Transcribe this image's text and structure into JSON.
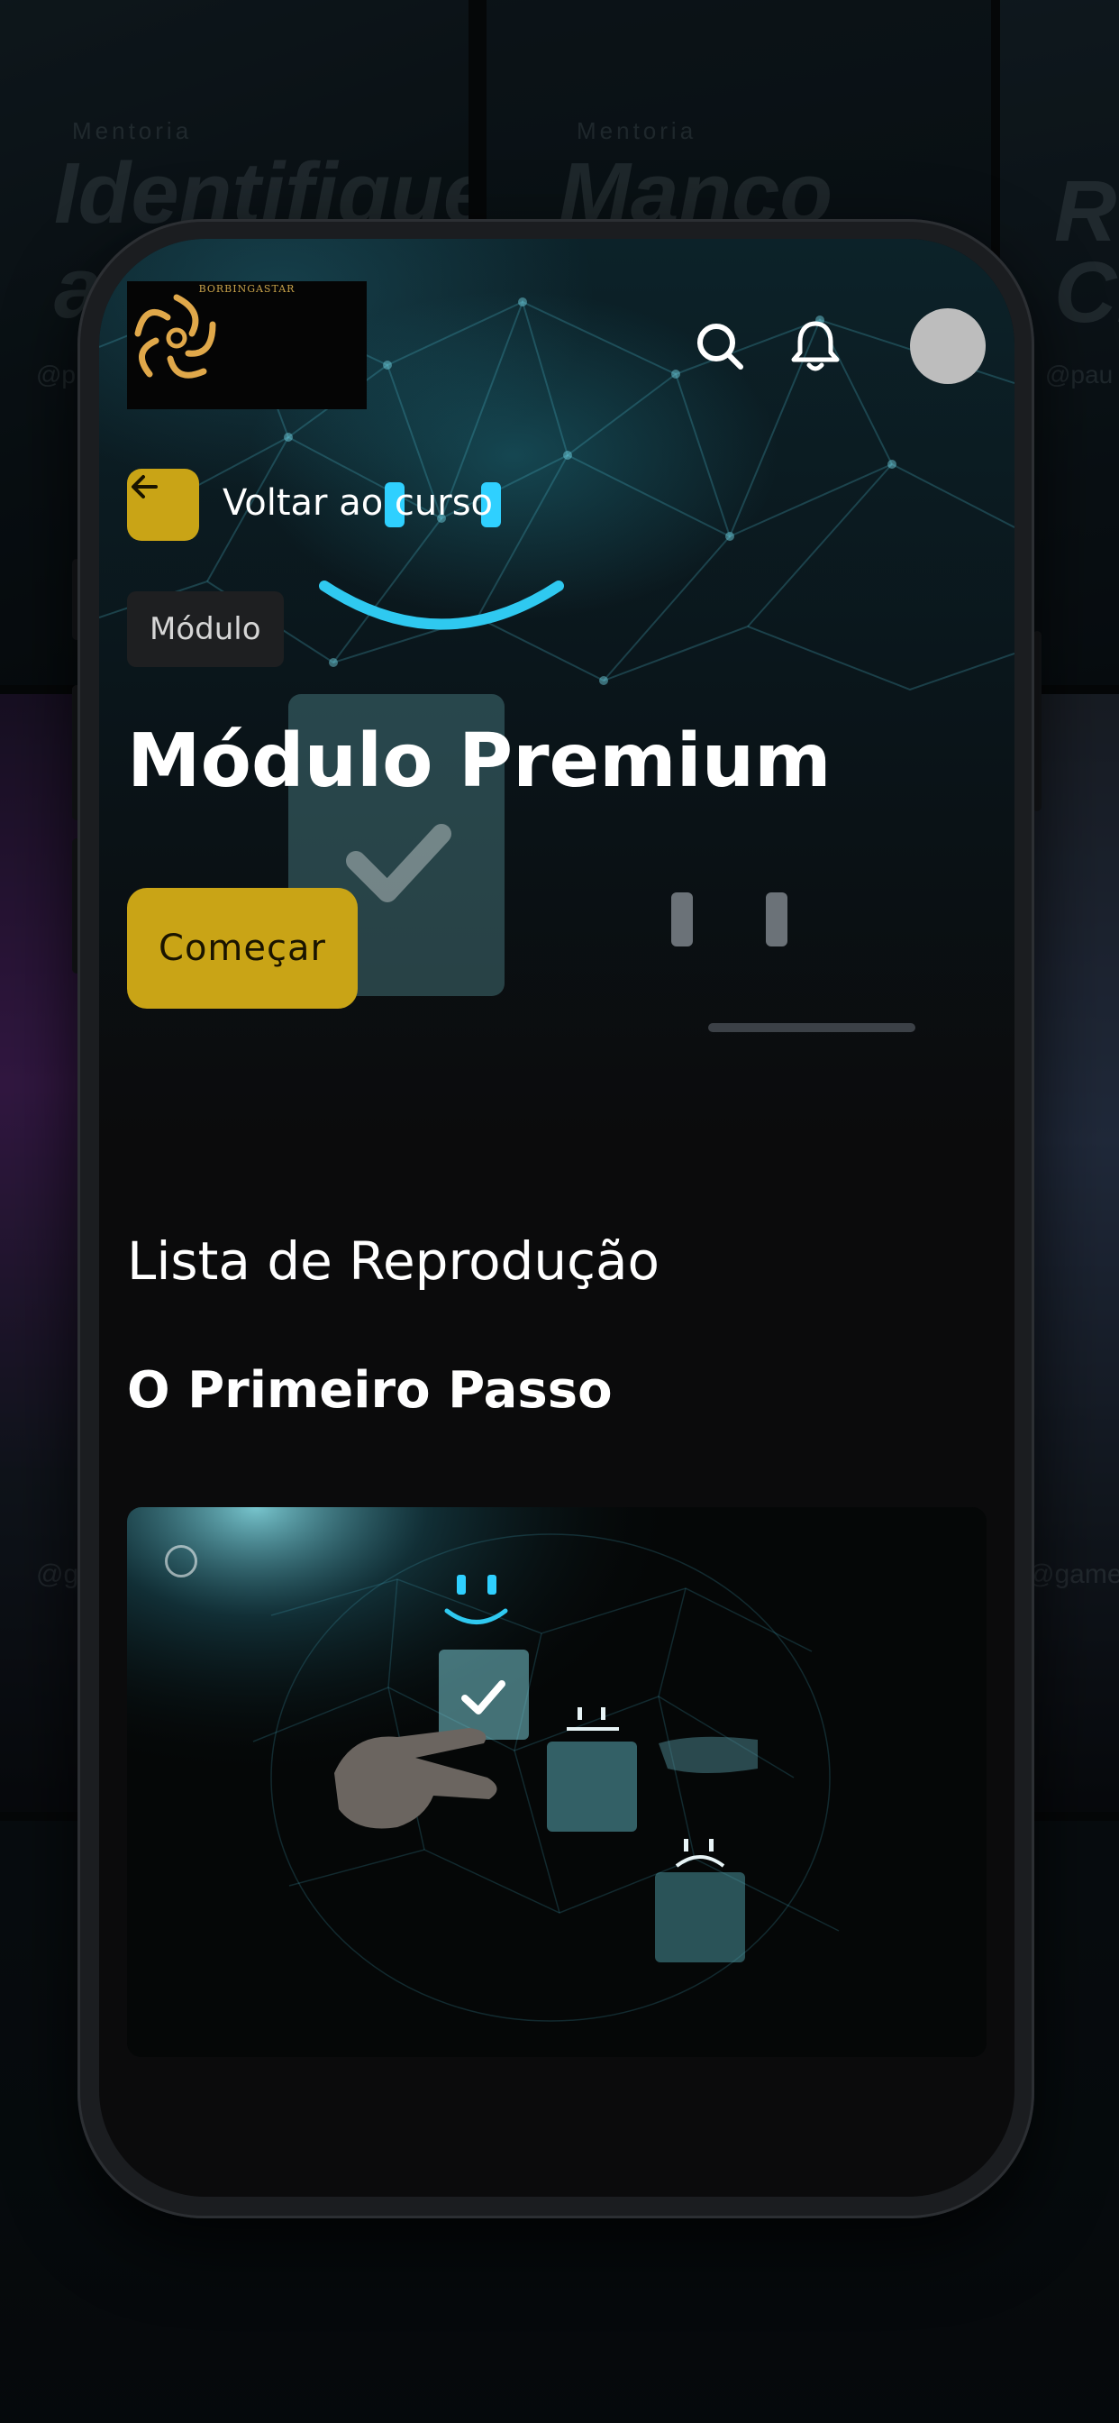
{
  "background": {
    "cards": [
      {
        "caption": "Mentoria",
        "title_line1": "Identifique",
        "title_line2": "a",
        "handle": "@p"
      },
      {
        "caption": "Mentoria",
        "title_line1": "Manco",
        "title_line2": "",
        "handle": ""
      },
      {
        "caption": "",
        "title_line1": "Re",
        "title_line2": "Cr",
        "handle": "@pau"
      }
    ],
    "side_left_handle": "@g",
    "side_right_handle": "@game"
  },
  "header": {
    "logo_text": "BORBINGASTAR",
    "search_icon": "search-icon",
    "bell_icon": "bell-icon"
  },
  "nav": {
    "back_label": "Voltar ao curso",
    "back_icon": "arrow-left-icon"
  },
  "module": {
    "tag": "Módulo",
    "title": "Módulo Premium",
    "cta_label": "Começar"
  },
  "playlist": {
    "heading": "Lista de Reprodução",
    "lesson_title": "O Primeiro Passo"
  },
  "colors": {
    "accent": "#c9a416",
    "background": "#0b0b0c",
    "text": "#ffffff",
    "tag_bg": "#1e1f21"
  }
}
